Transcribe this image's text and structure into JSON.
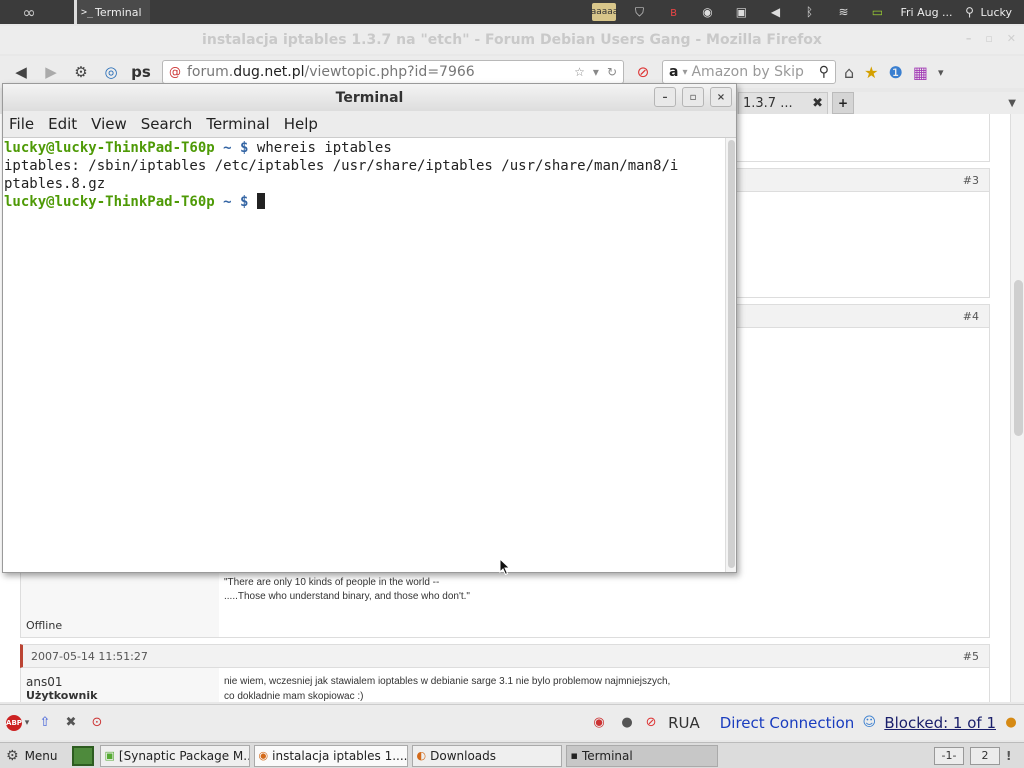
{
  "top_panel": {
    "task_label": "Terminal",
    "task_icon": ">_",
    "clock": "Fri Aug ...",
    "user": "Lucky",
    "tray_badge": "aaaaa",
    "tray_icons": [
      "network-icon",
      "shield-icon",
      "bluetooth-red-icon",
      "update-icon",
      "display-icon",
      "volume-icon",
      "bluetooth-icon",
      "wifi-icon",
      "battery-icon"
    ]
  },
  "firefox": {
    "title": "instalacja iptables 1.3.7 na \"etch\" - Forum Debian Users Gang - Mozilla Firefox",
    "url_prefix": "forum.",
    "url_domain": "dug.net.pl",
    "url_path": "/viewtopic.php?id=7966",
    "search_placeholder": "Amazon by Skip",
    "tab_label": "1.3.7 ...",
    "tab_close": "✖",
    "new_tab": "+",
    "page": {
      "post3_num": "#3",
      "post4_num": "#4",
      "sig_line1": "\"There are only 10 kinds of people in the world --",
      "sig_line2": ".....Those who understand binary, and those who don't.\"",
      "offline": "Offline",
      "post5_date": "2007-05-14 11:51:27",
      "post5_num": "#5",
      "post5_author": "ans01",
      "post5_role": "Użytkownik",
      "post5_line1": "nie wiem, wczesniej jak stawialem ioptables w debianie sarge 3.1 nie bylo problemow najmniejszych,",
      "post5_line2": "co dokladnie mam skopiowac :)"
    },
    "addon_bar": {
      "abp": "ABP",
      "lang": "RUA",
      "connection": "Direct Connection",
      "blocked": "Blocked: 1 of 1"
    }
  },
  "terminal": {
    "title": "Terminal",
    "window_buttons": [
      "–",
      "▫",
      "×"
    ],
    "menu": [
      "File",
      "Edit",
      "View",
      "Search",
      "Terminal",
      "Help"
    ],
    "prompt_user": "lucky@lucky-ThinkPad-T60p",
    "prompt_cwd": "~ $",
    "command": "whereis iptables",
    "output_line1": "iptables: /sbin/iptables /etc/iptables /usr/share/iptables /usr/share/man/man8/i",
    "output_line2": "ptables.8.gz"
  },
  "taskbar": {
    "menu_label": "Menu",
    "tasks": [
      "[Synaptic Package M...",
      "instalacja iptables 1....",
      "Downloads",
      "Terminal"
    ],
    "workspaces": [
      "-1-",
      "2"
    ],
    "end": "!"
  }
}
